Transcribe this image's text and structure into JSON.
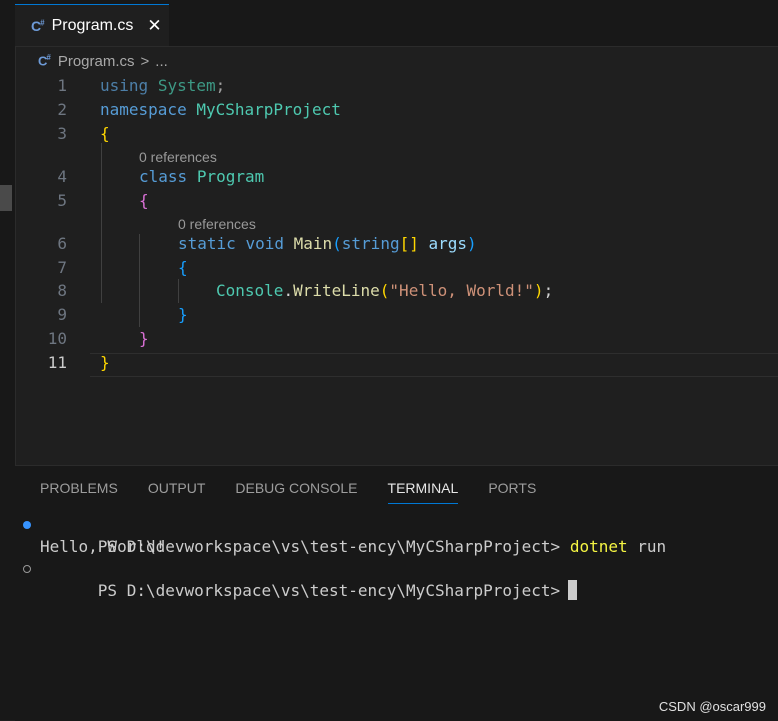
{
  "tab": {
    "icon": "csharp-file-icon",
    "icon_text": "C#",
    "label": "Program.cs",
    "close": "✕"
  },
  "breadcrumb": {
    "file": "Program.cs",
    "separator": ">",
    "ellipsis": "..."
  },
  "editor": {
    "active_line": 11,
    "line_numbers": [
      "1",
      "2",
      "3",
      "4",
      "5",
      "6",
      "7",
      "8",
      "9",
      "10",
      "11"
    ],
    "code_lens": [
      "0 references",
      "0 references"
    ],
    "lines": {
      "l1": {
        "kw": "using",
        "ns": "System",
        "end": ";"
      },
      "l2": {
        "kw": "namespace",
        "name": "MyCSharpProject"
      },
      "l3": {
        "brace": "{"
      },
      "l4": {
        "kw": "class",
        "name": "Program"
      },
      "l5": {
        "brace": "{"
      },
      "l6": {
        "kw1": "static",
        "kw2": "void",
        "fn": "Main",
        "paren_open": "(",
        "ptype": "string",
        "brackets": "[]",
        "pname": "args",
        "paren_close": ")"
      },
      "l7": {
        "brace": "{"
      },
      "l8": {
        "obj": "Console",
        "dot": ".",
        "fn": "WriteLine",
        "paren_open": "(",
        "str": "\"Hello, World!\"",
        "paren_close": ")",
        "end": ";"
      },
      "l9": {
        "brace": "}"
      },
      "l10": {
        "brace": "}"
      },
      "l11": {
        "brace": "}"
      }
    }
  },
  "panel": {
    "tabs": [
      "PROBLEMS",
      "OUTPUT",
      "DEBUG CONSOLE",
      "TERMINAL",
      "PORTS"
    ],
    "active_tab": "TERMINAL"
  },
  "terminal": {
    "line1_prompt": "PS D:\\devworkspace\\vs\\test-ency\\MyCSharpProject> ",
    "line1_cmd": "dotnet",
    "line1_arg": " run",
    "line2_output": "Hello, World!",
    "line3_prompt": "PS D:\\devworkspace\\vs\\test-ency\\MyCSharpProject>"
  },
  "watermark": "CSDN @oscar999",
  "colors": {
    "accent": "#0078d4",
    "keyword": "#569cd6",
    "type": "#4ec9b0",
    "function": "#dcdcaa",
    "string": "#ce9178"
  }
}
